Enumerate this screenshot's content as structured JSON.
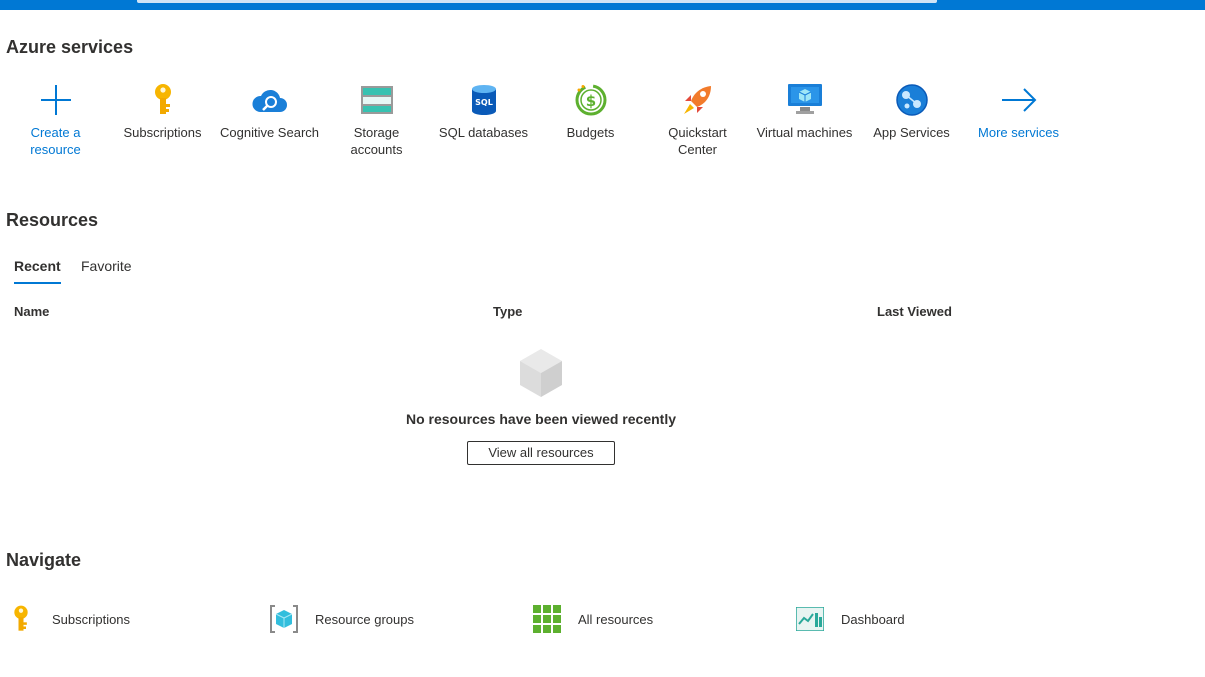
{
  "colors": {
    "accent": "#0078d4",
    "topbar": "#0078d4",
    "text": "#323130"
  },
  "sections": {
    "services_title": "Azure services",
    "resources_title": "Resources",
    "navigate_title": "Navigate"
  },
  "services": [
    {
      "label": "Create a resource",
      "icon": "plus-icon"
    },
    {
      "label": "Subscriptions",
      "icon": "key-icon"
    },
    {
      "label": "Cognitive Search",
      "icon": "cloud-search-icon"
    },
    {
      "label": "Storage accounts",
      "icon": "storage-icon"
    },
    {
      "label": "SQL databases",
      "icon": "sql-database-icon"
    },
    {
      "label": "Budgets",
      "icon": "budget-icon"
    },
    {
      "label": "Quickstart Center",
      "icon": "rocket-icon"
    },
    {
      "label": "Virtual machines",
      "icon": "monitor-icon"
    },
    {
      "label": "App Services",
      "icon": "globe-icon"
    },
    {
      "label": "More services",
      "icon": "arrow-right-icon"
    }
  ],
  "resources": {
    "tabs": [
      {
        "label": "Recent"
      },
      {
        "label": "Favorite"
      }
    ],
    "columns": {
      "name": "Name",
      "type": "Type",
      "last_viewed": "Last Viewed"
    },
    "empty_message": "No resources have been viewed recently",
    "view_all_label": "View all resources"
  },
  "navigate": [
    {
      "label": "Subscriptions",
      "icon": "key-icon"
    },
    {
      "label": "Resource groups",
      "icon": "resource-group-icon"
    },
    {
      "label": "All resources",
      "icon": "grid-icon"
    },
    {
      "label": "Dashboard",
      "icon": "dashboard-icon"
    }
  ]
}
